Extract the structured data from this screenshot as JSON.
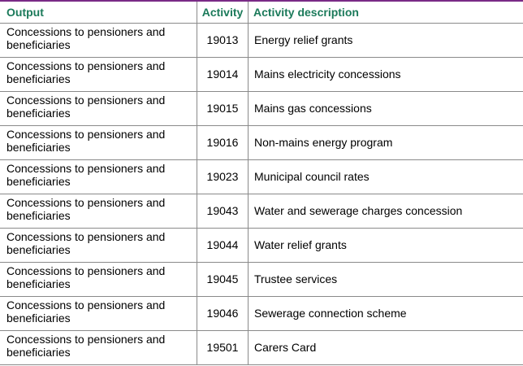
{
  "table": {
    "headers": {
      "output": "Output",
      "activity": "Activity",
      "description": "Activity description"
    },
    "rows": [
      {
        "output": "Concessions to pensioners and beneficiaries",
        "activity": "19013",
        "description": "Energy relief grants"
      },
      {
        "output": "Concessions to pensioners and beneficiaries",
        "activity": "19014",
        "description": "Mains electricity concessions"
      },
      {
        "output": "Concessions to pensioners and beneficiaries",
        "activity": "19015",
        "description": "Mains gas concessions"
      },
      {
        "output": "Concessions to pensioners and beneficiaries",
        "activity": "19016",
        "description": "Non-mains energy program"
      },
      {
        "output": "Concessions to pensioners and beneficiaries",
        "activity": "19023",
        "description": "Municipal council rates"
      },
      {
        "output": "Concessions to pensioners and beneficiaries",
        "activity": "19043",
        "description": "Water and sewerage charges concession"
      },
      {
        "output": "Concessions to pensioners and beneficiaries",
        "activity": "19044",
        "description": "Water relief grants"
      },
      {
        "output": "Concessions to pensioners and beneficiaries",
        "activity": "19045",
        "description": "Trustee services"
      },
      {
        "output": "Concessions to pensioners and beneficiaries",
        "activity": "19046",
        "description": "Sewerage connection scheme"
      },
      {
        "output": "Concessions to pensioners and beneficiaries",
        "activity": "19501",
        "description": "Carers Card"
      }
    ]
  },
  "colors": {
    "header_text": "#1b7a5a",
    "top_rule": "#7a2a86",
    "grid": "#8a8a8a"
  }
}
